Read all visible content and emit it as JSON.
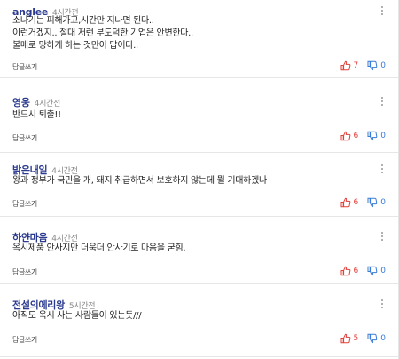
{
  "comments": [
    {
      "author": "anglee",
      "time": "4시간전",
      "lines": [
        "소나기는 피해가고,시간만 지나면 된다..",
        "이런거겠지.. 절대 저런 부도덕한 기업은 안변한다..",
        "불매로 망하게 하는 것만이 답이다.."
      ],
      "reply_label": "답글쓰기",
      "up": "7",
      "down": "0"
    },
    {
      "author": "영웅",
      "time": "4시간전",
      "lines": [
        "반드시 퇴출!!"
      ],
      "reply_label": "답글쓰기",
      "up": "6",
      "down": "0"
    },
    {
      "author": "밝은내일",
      "time": "4시간전",
      "lines": [
        "왕과 정부가 국민을 개, 돼지 취급하면서 보호하지 않는데 뭘 기대하겠나"
      ],
      "reply_label": "답글쓰기",
      "up": "6",
      "down": "0"
    },
    {
      "author": "하얀마음",
      "time": "4시간전",
      "lines": [
        "옥시제품 안사지만 더욱더 안사기로 마음을 굳힘."
      ],
      "reply_label": "답글쓰기",
      "up": "6",
      "down": "0"
    },
    {
      "author": "전설의에리왕",
      "time": "5시간전",
      "lines": [
        "아직도 옥시 사는 사람들이 있는듯///"
      ],
      "reply_label": "답글쓰기",
      "up": "5",
      "down": "0"
    }
  ]
}
